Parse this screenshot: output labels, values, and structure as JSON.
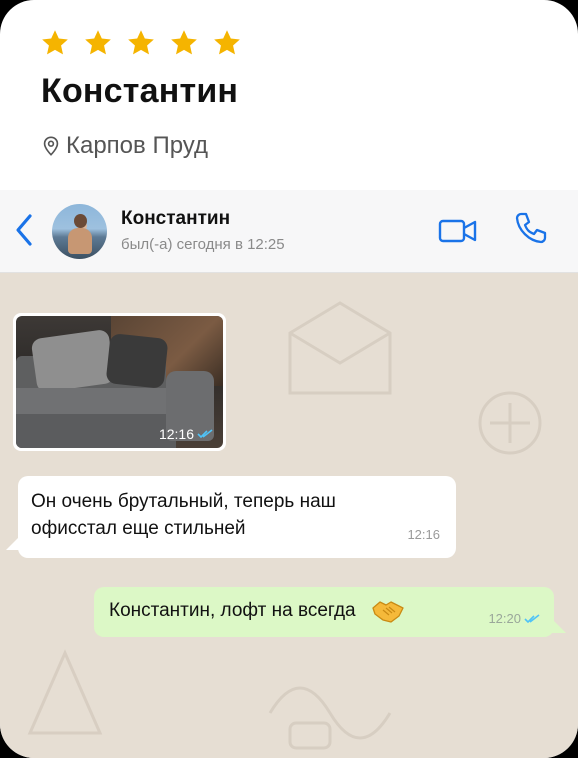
{
  "review": {
    "rating": 5,
    "max_rating": 5,
    "star_color": "#F5B400",
    "name": "Константин",
    "location": "Карпов Пруд"
  },
  "chat_header": {
    "contact_name": "Константин",
    "last_seen": "был(-а) сегодня в 12:25",
    "accent_color": "#1A73E8",
    "icons": [
      "back-chevron-icon",
      "video-call-icon",
      "phone-icon"
    ]
  },
  "messages": [
    {
      "type": "image",
      "direction": "incoming",
      "image_desc": "gray sofa",
      "time": "12:16",
      "status": "read"
    },
    {
      "type": "text",
      "direction": "incoming",
      "text": "Он очень брутальный, теперь наш офисстал еще стильней",
      "time": "12:16"
    },
    {
      "type": "text",
      "direction": "outgoing",
      "text": "Константин, лофт на всегда",
      "emoji": "handshake",
      "time": "12:20",
      "status": "read"
    }
  ],
  "colors": {
    "chat_background": "#E6DED3",
    "outgoing_bubble": "#DCF8C6",
    "incoming_bubble": "#FFFFFF"
  }
}
